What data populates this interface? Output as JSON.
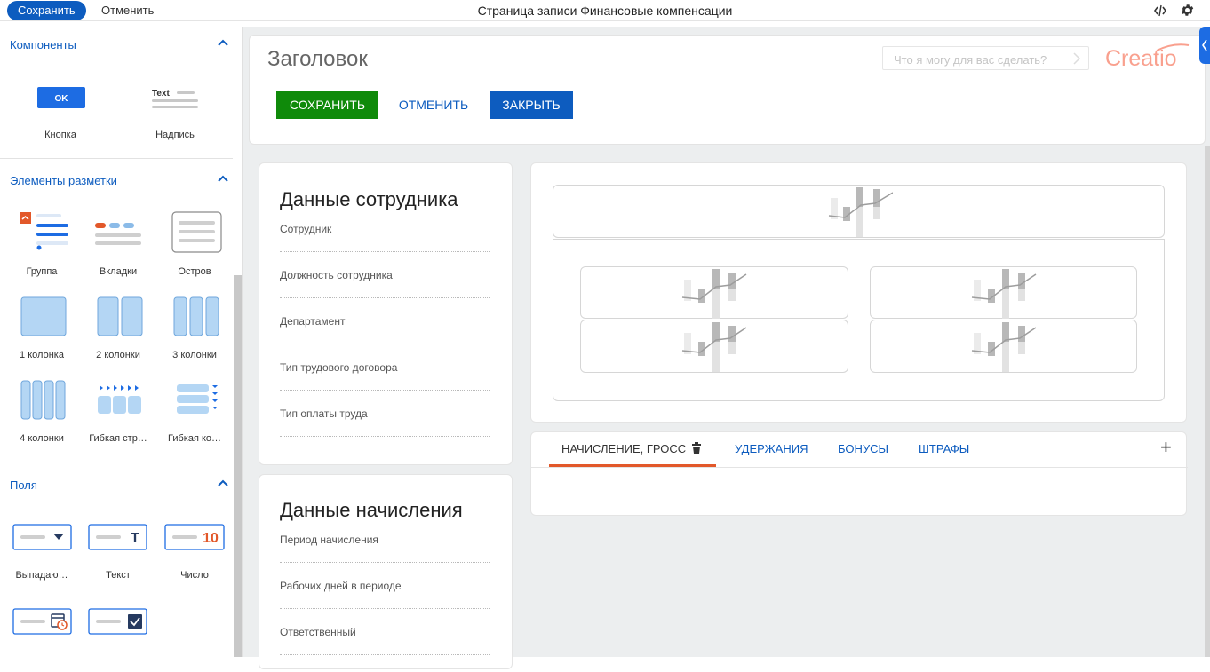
{
  "topbar": {
    "save_label": "Сохранить",
    "cancel_label": "Отменить",
    "title": "Страница записи Финансовые компенсации",
    "code_icon": "code-icon",
    "settings_icon": "gear-icon"
  },
  "sidebar": {
    "sections": [
      {
        "label": "Компоненты"
      },
      {
        "label": "Элементы разметки"
      },
      {
        "label": "Поля"
      }
    ],
    "components": [
      {
        "label": "Кнопка",
        "icon": "button-preview-icon",
        "preview_text": "OK"
      },
      {
        "label": "Надпись",
        "icon": "label-preview-icon",
        "preview_text": "Text"
      }
    ],
    "layout": [
      {
        "label": "Группа",
        "icon": "group-icon"
      },
      {
        "label": "Вкладки",
        "icon": "tabs-icon"
      },
      {
        "label": "Остров",
        "icon": "island-icon"
      },
      {
        "label": "1 колонка",
        "icon": "one-column-icon"
      },
      {
        "label": "2 колонки",
        "icon": "two-columns-icon"
      },
      {
        "label": "3 колонки",
        "icon": "three-columns-icon"
      },
      {
        "label": "4 колонки",
        "icon": "four-columns-icon"
      },
      {
        "label": "Гибкая стр…",
        "icon": "flex-row-icon"
      },
      {
        "label": "Гибкая ко…",
        "icon": "flex-column-icon"
      }
    ],
    "fields": [
      {
        "label": "Выпадаю…",
        "icon": "dropdown-field-icon"
      },
      {
        "label": "Текст",
        "icon": "text-field-icon",
        "preview_text": "T"
      },
      {
        "label": "Число",
        "icon": "number-field-icon",
        "preview_text": "10"
      },
      {
        "label": "",
        "icon": "date-field-icon"
      },
      {
        "label": "",
        "icon": "checkbox-field-icon"
      }
    ]
  },
  "header": {
    "title": "Заголовок",
    "search_placeholder": "Что я могу для вас сделать?",
    "logo": "Creatio",
    "buttons": {
      "save": "СОХРАНИТЬ",
      "cancel": "ОТМЕНИТЬ",
      "close": "ЗАКРЫТЬ"
    }
  },
  "employee_card": {
    "title": "Данные сотрудника",
    "fields": [
      "Сотрудник",
      "Должность сотрудника",
      "Департамент",
      "Тип трудового договора",
      "Тип оплаты труда"
    ]
  },
  "accrual_card": {
    "title": "Данные начисления",
    "fields": [
      "Период начисления",
      "Рабочих дней в периоде",
      "Ответственный"
    ]
  },
  "tabs": {
    "items": [
      "НАЧИСЛЕНИЕ, ГРОСС",
      "УДЕРЖАНИЯ",
      "БОНУСЫ",
      "ШТРАФЫ"
    ],
    "active_index": 0,
    "add_label": "+"
  },
  "colors": {
    "brand_blue": "#0d5cbf",
    "save_green": "#0f8a0a",
    "tab_active": "#e2582a",
    "logo": "#f9a08e"
  }
}
